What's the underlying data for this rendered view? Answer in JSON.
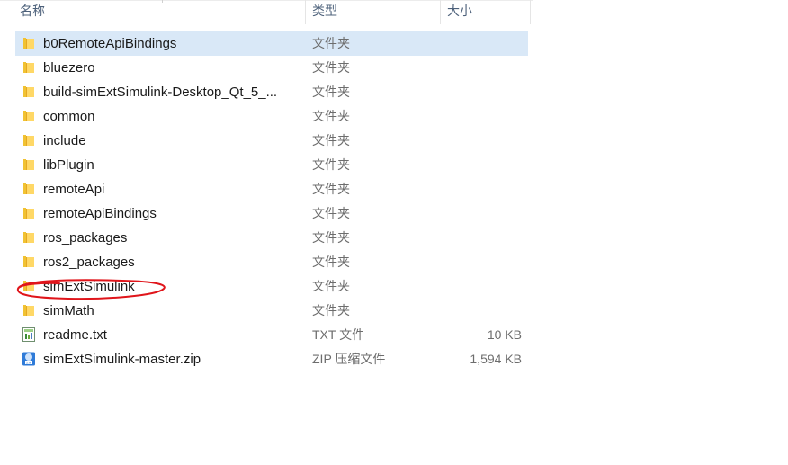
{
  "columns": {
    "name": "名称",
    "type": "类型",
    "size": "大小"
  },
  "files": [
    {
      "name": "b0RemoteApiBindings",
      "type": "文件夹",
      "size": "",
      "icon": "folder-icon",
      "selected": true
    },
    {
      "name": "bluezero",
      "type": "文件夹",
      "size": "",
      "icon": "folder-icon"
    },
    {
      "name": "build-simExtSimulink-Desktop_Qt_5_...",
      "type": "文件夹",
      "size": "",
      "icon": "folder-icon"
    },
    {
      "name": "common",
      "type": "文件夹",
      "size": "",
      "icon": "folder-icon"
    },
    {
      "name": "include",
      "type": "文件夹",
      "size": "",
      "icon": "folder-icon"
    },
    {
      "name": "libPlugin",
      "type": "文件夹",
      "size": "",
      "icon": "folder-icon"
    },
    {
      "name": "remoteApi",
      "type": "文件夹",
      "size": "",
      "icon": "folder-icon"
    },
    {
      "name": "remoteApiBindings",
      "type": "文件夹",
      "size": "",
      "icon": "folder-icon"
    },
    {
      "name": "ros_packages",
      "type": "文件夹",
      "size": "",
      "icon": "folder-icon"
    },
    {
      "name": "ros2_packages",
      "type": "文件夹",
      "size": "",
      "icon": "folder-icon"
    },
    {
      "name": "simExtSimulink",
      "type": "文件夹",
      "size": "",
      "icon": "folder-icon",
      "annotated": true
    },
    {
      "name": "simMath",
      "type": "文件夹",
      "size": "",
      "icon": "folder-icon"
    },
    {
      "name": "readme.txt",
      "type": "TXT 文件",
      "size": "10 KB",
      "icon": "text-file-icon"
    },
    {
      "name": "simExtSimulink-master.zip",
      "type": "ZIP 压缩文件",
      "size": "1,594 KB",
      "icon": "zip-file-icon"
    }
  ],
  "colors": {
    "selected_row": "#d9e8f7",
    "folder": "#f1c232",
    "annotation": "#e0151b"
  }
}
